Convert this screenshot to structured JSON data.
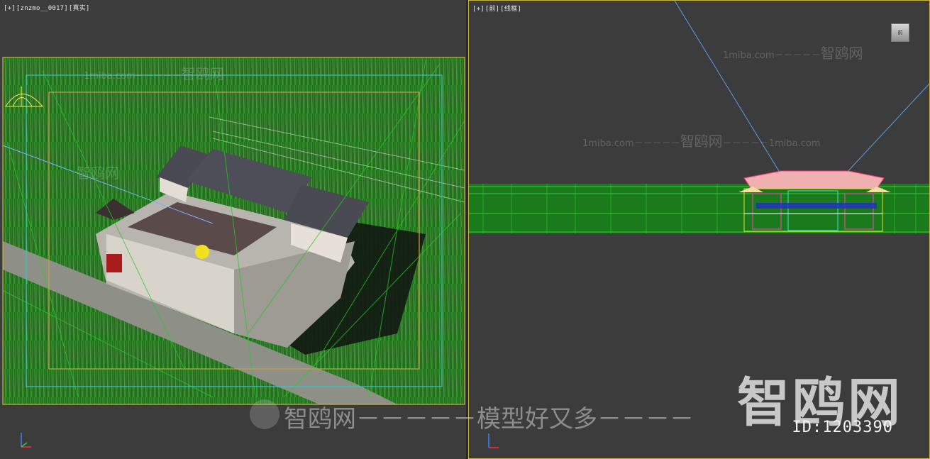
{
  "viewport_left": {
    "label_plus": "[+]",
    "label_camera": "[znzmo__0017]",
    "label_mode": "[真实]"
  },
  "viewport_right": {
    "label_plus": "[+]",
    "label_view": "[前]",
    "label_mode": "[线框]"
  },
  "watermarks": {
    "domain": "1miba.com",
    "dashes": "－－－－－",
    "site_name": "智鸥网",
    "big": "智鸥网",
    "id": "ID:1203390",
    "slogan": "智鸥网－－－－－模型好又多－－－－"
  },
  "colors": {
    "background": "#3c3c3c",
    "grass": "#1f8a1f",
    "safe_frame_outer": "#c9b640",
    "safe_frame_mid": "#36c7c7",
    "safe_frame_inner": "#c9a040",
    "camera_line": "#7ab0ff"
  }
}
